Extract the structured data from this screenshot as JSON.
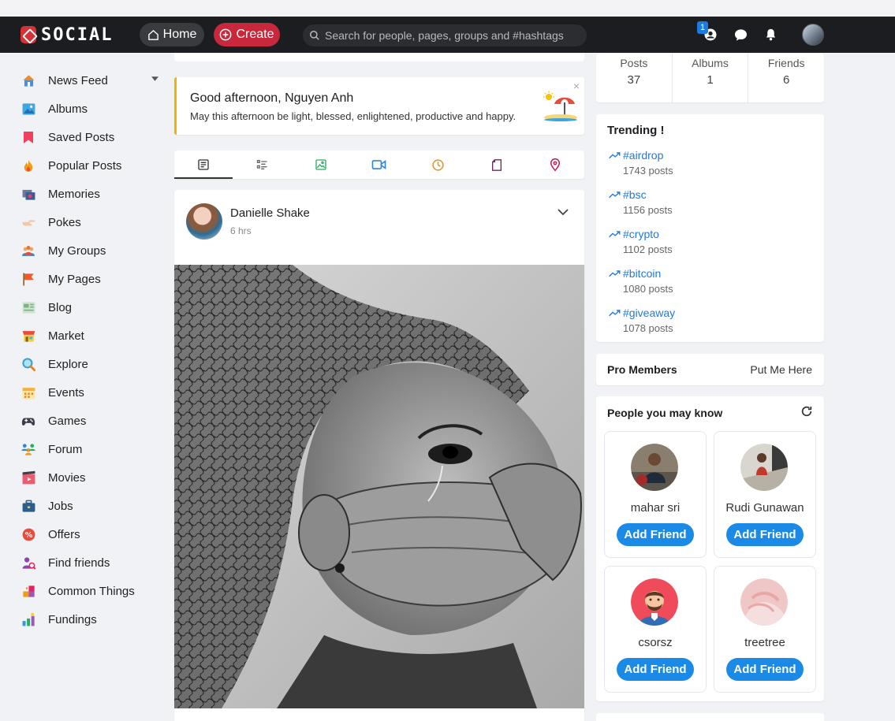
{
  "topbar": {
    "logo_text": "SOCIAL",
    "home_label": "Home",
    "create_label": "Create",
    "search_placeholder": "Search for people, pages, groups and #hashtags",
    "requests_badge": "1"
  },
  "sidebar": {
    "items": [
      {
        "label": "News Feed",
        "icon": "home-icon"
      },
      {
        "label": "Albums",
        "icon": "albums-icon"
      },
      {
        "label": "Saved Posts",
        "icon": "bookmark-icon"
      },
      {
        "label": "Popular Posts",
        "icon": "fire-icon"
      },
      {
        "label": "Memories",
        "icon": "memories-icon"
      },
      {
        "label": "Pokes",
        "icon": "poke-icon"
      },
      {
        "label": "My Groups",
        "icon": "groups-icon"
      },
      {
        "label": "My Pages",
        "icon": "flag-icon"
      },
      {
        "label": "Blog",
        "icon": "blog-icon"
      },
      {
        "label": "Market",
        "icon": "market-icon"
      },
      {
        "label": "Explore",
        "icon": "explore-icon"
      },
      {
        "label": "Events",
        "icon": "calendar-icon"
      },
      {
        "label": "Games",
        "icon": "gamepad-icon"
      },
      {
        "label": "Forum",
        "icon": "forum-icon"
      },
      {
        "label": "Movies",
        "icon": "movies-icon"
      },
      {
        "label": "Jobs",
        "icon": "briefcase-icon"
      },
      {
        "label": "Offers",
        "icon": "offers-icon"
      },
      {
        "label": "Find friends",
        "icon": "find-friends-icon"
      },
      {
        "label": "Common Things",
        "icon": "puzzle-icon"
      },
      {
        "label": "Fundings",
        "icon": "fundings-icon"
      }
    ]
  },
  "greeting": {
    "title": "Good afternoon, Nguyen Anh",
    "message": "May this afternoon be light, blessed, enlightened, productive and happy.",
    "close": "×"
  },
  "composer_tabs": [
    "text-post",
    "list-post",
    "photo-post",
    "video-post",
    "activity-post",
    "file-post",
    "location-post"
  ],
  "post": {
    "author": "Danielle Shake",
    "time": "6 hrs"
  },
  "profile_stats": [
    {
      "label": "Posts",
      "value": "37"
    },
    {
      "label": "Albums",
      "value": "1"
    },
    {
      "label": "Friends",
      "value": "6"
    }
  ],
  "trending": {
    "title": "Trending !",
    "items": [
      {
        "tag": "#airdrop",
        "count": "1743 posts"
      },
      {
        "tag": "#bsc",
        "count": "1156 posts"
      },
      {
        "tag": "#crypto",
        "count": "1102 posts"
      },
      {
        "tag": "#bitcoin",
        "count": "1080 posts"
      },
      {
        "tag": "#giveaway",
        "count": "1078 posts"
      }
    ]
  },
  "pro_members": {
    "title": "Pro Members",
    "link": "Put Me Here"
  },
  "people": {
    "title": "People you may know",
    "add_label": "Add Friend",
    "items": [
      {
        "name": "mahar sri"
      },
      {
        "name": "Rudi Gunawan"
      },
      {
        "name": "csorsz"
      },
      {
        "name": "treetree"
      }
    ]
  },
  "colors": {
    "topbar": "#1b1d21",
    "create": "#c7283b",
    "accent": "#1a8ae6",
    "greeting_border": "#f0b400"
  }
}
